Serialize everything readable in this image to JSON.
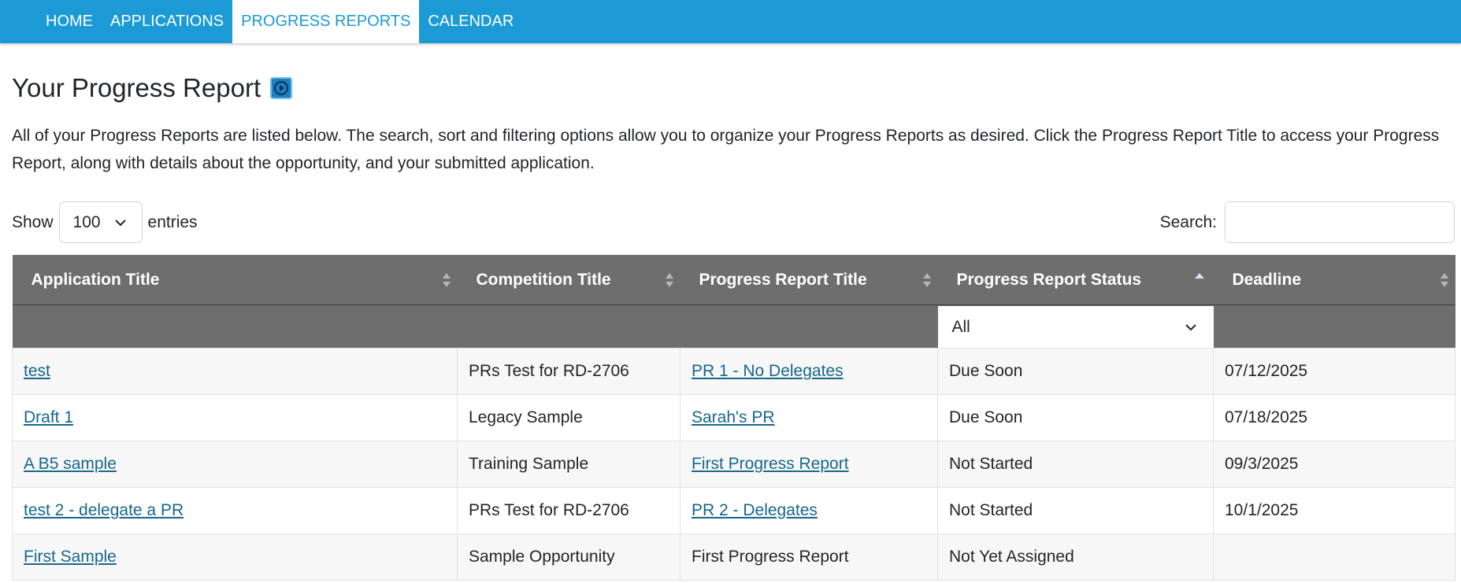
{
  "nav": {
    "items": [
      {
        "label": "HOME",
        "active": false
      },
      {
        "label": "APPLICATIONS",
        "active": false
      },
      {
        "label": "PROGRESS REPORTS",
        "active": true
      },
      {
        "label": "CALENDAR",
        "active": false
      }
    ]
  },
  "page": {
    "title": "Your Progress Report",
    "help_icon": "play-circle-icon",
    "intro": "All of your Progress Reports are listed below. The search, sort and filtering options allow you to organize your Progress Reports as desired. Click the Progress Report Title to access your Progress Report, along with details about the opportunity, and your submitted application."
  },
  "controls": {
    "show_label": "Show",
    "entries_value": "100",
    "entries_label": "entries",
    "search_label": "Search:",
    "search_value": ""
  },
  "table": {
    "columns": [
      {
        "label": "Application Title",
        "sort": "none"
      },
      {
        "label": "Competition Title",
        "sort": "none"
      },
      {
        "label": "Progress Report Title",
        "sort": "none"
      },
      {
        "label": "Progress Report Status",
        "sort": "asc"
      },
      {
        "label": "Deadline",
        "sort": "none"
      }
    ],
    "status_filter": "All",
    "rows": [
      {
        "application": "test",
        "competition": "PRs Test for RD-2706",
        "report": "PR 1 - No Delegates",
        "report_link": true,
        "status": "Due Soon",
        "deadline": "07/12/2025"
      },
      {
        "application": "Draft 1",
        "competition": "Legacy Sample",
        "report": "Sarah's PR",
        "report_link": true,
        "status": "Due Soon",
        "deadline": "07/18/2025"
      },
      {
        "application": "A B5 sample",
        "competition": "Training Sample",
        "report": "First Progress Report",
        "report_link": true,
        "status": "Not Started",
        "deadline": "09/3/2025"
      },
      {
        "application": "test 2 - delegate a PR",
        "competition": "PRs Test for RD-2706",
        "report": "PR 2 - Delegates",
        "report_link": true,
        "status": "Not Started",
        "deadline": "10/1/2025"
      },
      {
        "application": "First Sample",
        "competition": "Sample Opportunity",
        "report": "First Progress Report",
        "report_link": false,
        "status": "Not Yet Assigned",
        "deadline": ""
      }
    ]
  },
  "colors": {
    "nav_bg": "#1b9ad6",
    "header_bg": "#6e6e6e",
    "link": "#17678b"
  }
}
